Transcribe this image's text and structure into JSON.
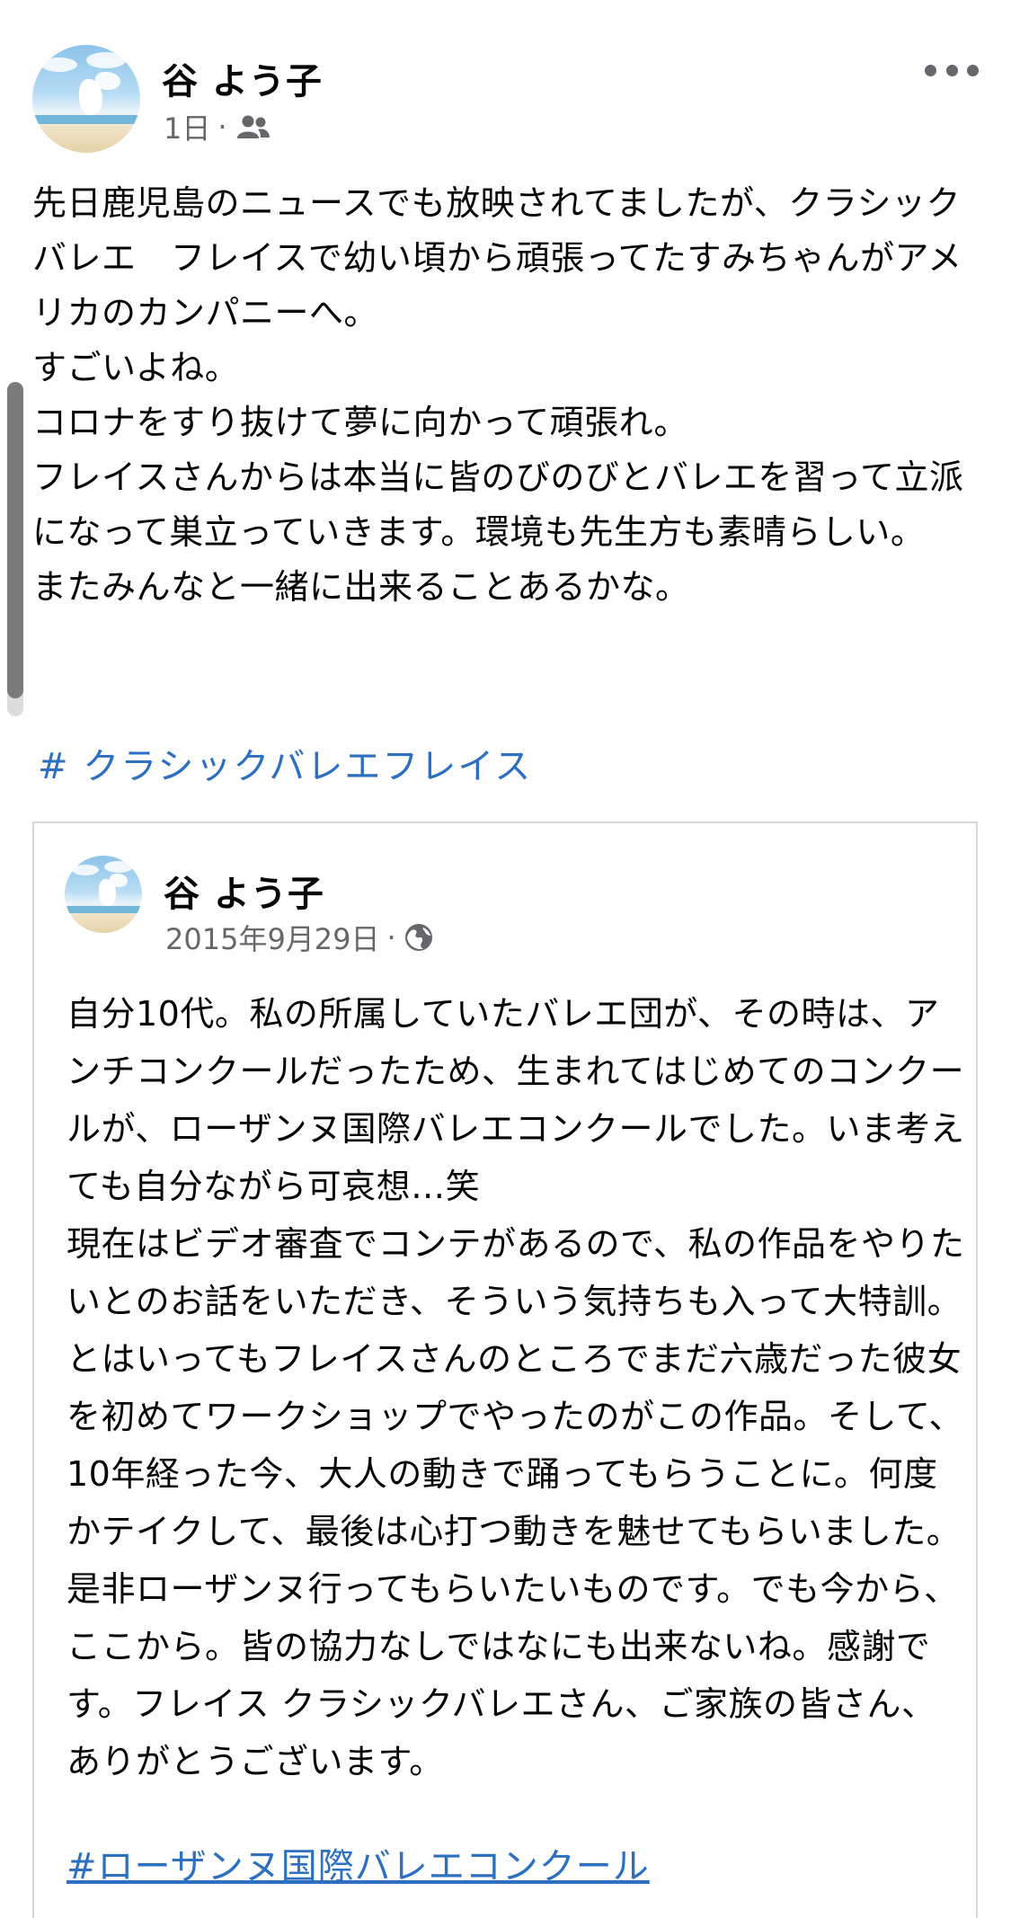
{
  "post": {
    "author": "谷 よう子",
    "time": "1日",
    "separator": "·",
    "audience_icon": "friends-icon",
    "more_icon": "more-options-icon",
    "body": "先日鹿児島のニュースでも放映されてましたが、クラシックバレエ　フレイスで幼い頃から頑張ってたすみちゃんがアメリカのカンパニーへ。\nすごいよね。\nコロナをすり抜けて夢に向かって頑張れ。\nフレイスさんからは本当に皆のびのびとバレエを習って立派になって巣立っていきます。環境も先生方も素晴らしい。\nまたみんなと一緒に出来ることあるかな。",
    "hashtag": "# クラシックバレエフレイス"
  },
  "shared_post": {
    "author": "谷 よう子",
    "date": "2015年9月29日",
    "separator": "·",
    "audience_icon": "globe-icon",
    "body": "自分10代。私の所属していたバレエ団が、その時は、アンチコンクールだったため、生まれてはじめてのコンクールが、ローザンヌ国際バレエコンクールでした。いま考えても自分ながら可哀想…笑\n現在はビデオ審査でコンテがあるので、私の作品をやりたいとのお話をいただき、そういう気持ちも入って大特訓。とはいってもフレイスさんのところでまだ六歳だった彼女を初めてワークショップでやったのがこの作品。そして、10年経った今、大人の動きで踊ってもらうことに。何度かテイクして、最後は心打つ動きを魅せてもらいました。是非ローザンヌ行ってもらいたいものです。でも今から、ここから。皆の協力なしではなにも出来ないね。感謝です。フレイス クラシックバレエさん、ご家族の皆さん、ありがとうございます。",
    "hashtag": "#ローザンヌ国際バレエコンクール"
  }
}
